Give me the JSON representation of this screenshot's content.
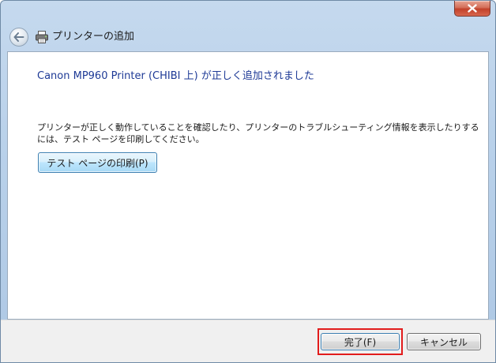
{
  "window": {
    "title": "プリンターの追加",
    "close_label": "閉じる"
  },
  "content": {
    "heading": "Canon MP960 Printer (CHIBI 上) が正しく追加されました",
    "description": "プリンターが正しく動作していることを確認したり、プリンターのトラブルシューティング情報を表示したりするには、テスト ページを印刷してください。",
    "test_page_button": "テスト ページの印刷(P)"
  },
  "footer": {
    "finish_button": "完了(F)",
    "cancel_button": "キャンセル"
  },
  "colors": {
    "heading": "#1e3a96",
    "highlight": "#e21c1c",
    "close": "#c2412a"
  },
  "icons": {
    "close": "close-icon",
    "back": "back-arrow-icon",
    "printer": "printer-icon"
  }
}
